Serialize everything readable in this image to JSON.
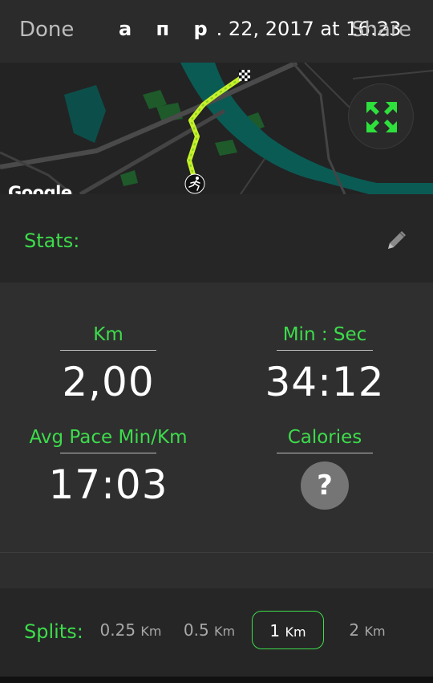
{
  "header": {
    "done_label": "Done",
    "title_month": "а п р",
    "title_rest": ". 22, 2017 at 16:23",
    "share_label": "Share"
  },
  "map": {
    "attribution": "Google",
    "route_color": "#c8f02a",
    "water_color": "#0b5b55",
    "park_color": "#1e5a2a"
  },
  "stats": {
    "header_label": "Stats:",
    "distance": {
      "label": "Km",
      "value": "2,00"
    },
    "duration": {
      "label": "Min : Sec",
      "value": "34:12"
    },
    "pace": {
      "label": "Avg Pace Min/Km",
      "value": "17:03"
    },
    "calories": {
      "label": "Calories",
      "value": "?"
    }
  },
  "splits": {
    "label": "Splits:",
    "options": [
      {
        "value": "0.25",
        "unit": "Km"
      },
      {
        "value": "0.5",
        "unit": "Km"
      },
      {
        "value": "1",
        "unit": "Km"
      },
      {
        "value": "2",
        "unit": "Km"
      }
    ],
    "selected": "1"
  },
  "colors": {
    "accent_green": "#3ddc4b",
    "background": "#2e2e2e"
  }
}
